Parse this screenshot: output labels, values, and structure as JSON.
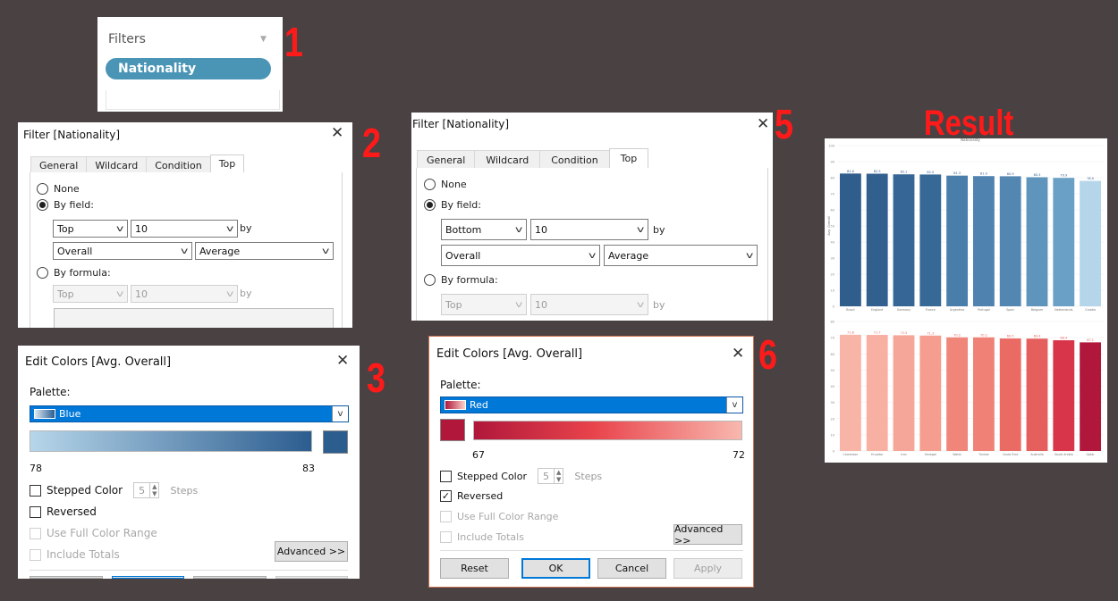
{
  "steps": [
    "1",
    "2",
    "3",
    "5",
    "6"
  ],
  "result_label": "Result",
  "filters_card": {
    "title": "Filters",
    "pill": "Nationality",
    "pill_color": "#4a95b6"
  },
  "filter_dialog": {
    "title": "Filter [Nationality]",
    "tabs": [
      "General",
      "Wildcard",
      "Condition",
      "Top"
    ],
    "active_tab": "Top",
    "none_label": "None",
    "by_field_label": "By field:",
    "by_formula_label": "By formula:",
    "by_label": "by",
    "field_value": "10",
    "field_measure": "Overall",
    "field_agg": "Average",
    "formula_direction": "Top",
    "formula_value": "10"
  },
  "filter_a": {
    "direction": "Top"
  },
  "filter_b": {
    "direction": "Bottom"
  },
  "edit_colors": {
    "title": "Edit Colors [Avg. Overall]",
    "palette_label": "Palette:",
    "stepped_label": "Stepped Color",
    "steps_value": "5",
    "steps_label": "Steps",
    "reversed_label": "Reversed",
    "full_range_label": "Use Full Color Range",
    "include_totals_label": "Include Totals",
    "advanced_label": "Advanced >>",
    "reset_label": "Reset",
    "ok_label": "OK",
    "cancel_label": "Cancel",
    "apply_label": "Apply"
  },
  "colors_a": {
    "palette": "Blue",
    "min": "78",
    "max": "83",
    "reversed": false,
    "start_color": "#b6d6ea",
    "end_color": "#2c5d8f"
  },
  "colors_b": {
    "palette": "Red",
    "min": "67",
    "max": "72",
    "reversed": true,
    "start_color": "#b0173a",
    "end_color": "#f8b8ae"
  },
  "chart_data": [
    {
      "type": "bar",
      "title": "Nationality",
      "ylabel": "Avg. Overall",
      "ylim": [
        0,
        100
      ],
      "yticks": [
        "100",
        "90",
        "80",
        "70",
        "60",
        "50",
        "40",
        "30",
        "20",
        "10",
        "0"
      ],
      "categories": [
        "Brazil",
        "England",
        "Germany",
        "France",
        "Argentina",
        "Portugal",
        "Spain",
        "Belgium",
        "Netherlands",
        "Croatia"
      ],
      "values": [
        82.6,
        82.5,
        82.1,
        82.0,
        81.3,
        81.0,
        80.9,
        80.3,
        79.9,
        78.0
      ],
      "colors": [
        "#2f5d8c",
        "#31608f",
        "#356695",
        "#376996",
        "#4a7eaa",
        "#4f82ae",
        "#5387b2",
        "#5f94bc",
        "#6aa0c6",
        "#b4d5ea"
      ]
    },
    {
      "type": "bar",
      "ylim": [
        0,
        80
      ],
      "yticks": [
        "80",
        "70",
        "60",
        "50",
        "40",
        "30",
        "20",
        "10",
        "0"
      ],
      "categories": [
        "Cameroon",
        "Ecuador",
        "Iran",
        "Senegal",
        "Wales",
        "Tunisia",
        "Costa Rica",
        "Australia",
        "Saudi Arabia",
        "Qatar"
      ],
      "values": [
        71.8,
        71.7,
        71.5,
        71.3,
        70.2,
        70.2,
        69.5,
        69.4,
        68.4,
        67.1
      ],
      "colors": [
        "#f9b4a8",
        "#f8b0a3",
        "#f6a698",
        "#f59d8e",
        "#f0857a",
        "#ef8176",
        "#ea6b64",
        "#e55f5c",
        "#d8344a",
        "#b0173a"
      ]
    }
  ]
}
